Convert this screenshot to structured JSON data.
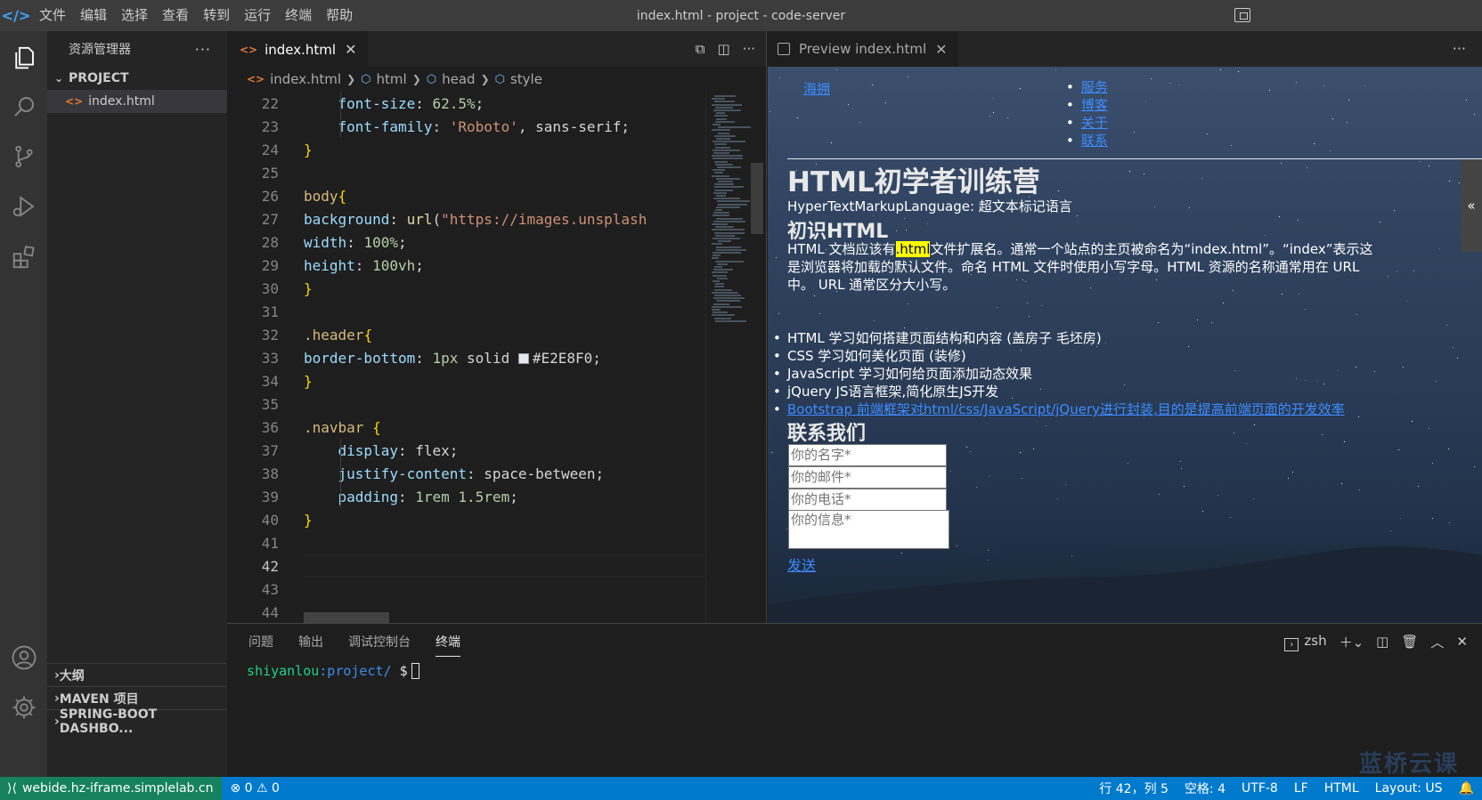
{
  "titlebar": {
    "menu": [
      "文件",
      "编辑",
      "选择",
      "查看",
      "转到",
      "运行",
      "终端",
      "帮助"
    ],
    "window_title": "index.html - project - code-server"
  },
  "sidebar": {
    "title": "资源管理器",
    "more": "···",
    "project_label": "PROJECT",
    "file": "index.html",
    "bottom_sections": [
      "大纲",
      "MAVEN 项目",
      "SPRING-BOOT DASHBO..."
    ]
  },
  "editor": {
    "tab_label": "index.html",
    "tab_close": "✕",
    "breadcrumb": [
      "index.html",
      "html",
      "head",
      "style"
    ],
    "lines": [
      {
        "n": "22",
        "parts": [
          [
            "p",
            "    font-size"
          ],
          [
            "d",
            ": "
          ],
          [
            "n",
            "62.5%"
          ],
          [
            "d",
            ";"
          ]
        ]
      },
      {
        "n": "23",
        "parts": [
          [
            "p",
            "    font-family"
          ],
          [
            "d",
            ": "
          ],
          [
            "s",
            "'Roboto'"
          ],
          [
            "d",
            ", sans-serif;"
          ]
        ]
      },
      {
        "n": "24",
        "parts": [
          [
            "b",
            "}"
          ]
        ]
      },
      {
        "n": "25",
        "parts": []
      },
      {
        "n": "26",
        "parts": [
          [
            "sel",
            "body"
          ],
          [
            "b",
            "{"
          ]
        ]
      },
      {
        "n": "27",
        "parts": [
          [
            "p",
            "background"
          ],
          [
            "d",
            ": "
          ],
          [
            "f",
            "url"
          ],
          [
            "d",
            "("
          ],
          [
            "s",
            "\"https://images.unsplash"
          ]
        ]
      },
      {
        "n": "28",
        "parts": [
          [
            "p",
            "width"
          ],
          [
            "d",
            ": "
          ],
          [
            "n",
            "100%"
          ],
          [
            "d",
            ";"
          ]
        ]
      },
      {
        "n": "29",
        "parts": [
          [
            "p",
            "height"
          ],
          [
            "d",
            ": "
          ],
          [
            "n",
            "100vh"
          ],
          [
            "d",
            ";"
          ]
        ]
      },
      {
        "n": "30",
        "parts": [
          [
            "b",
            "}"
          ]
        ]
      },
      {
        "n": "31",
        "parts": []
      },
      {
        "n": "32",
        "parts": [
          [
            "sel",
            ".header"
          ],
          [
            "b",
            "{"
          ]
        ]
      },
      {
        "n": "33",
        "parts": [
          [
            "p",
            "border-bottom"
          ],
          [
            "d",
            ": "
          ],
          [
            "n",
            "1px"
          ],
          [
            "d",
            " solid "
          ],
          [
            "sw",
            ""
          ],
          [
            "d",
            "#E2E8F0;"
          ]
        ]
      },
      {
        "n": "34",
        "parts": [
          [
            "b",
            "}"
          ]
        ]
      },
      {
        "n": "35",
        "parts": []
      },
      {
        "n": "36",
        "parts": [
          [
            "sel",
            ".navbar "
          ],
          [
            "b",
            "{"
          ]
        ]
      },
      {
        "n": "37",
        "parts": [
          [
            "p",
            "    display"
          ],
          [
            "d",
            ": flex;"
          ]
        ]
      },
      {
        "n": "38",
        "parts": [
          [
            "p",
            "    justify-content"
          ],
          [
            "d",
            ": space-between;"
          ]
        ]
      },
      {
        "n": "39",
        "parts": [
          [
            "p",
            "    padding"
          ],
          [
            "d",
            ": "
          ],
          [
            "n",
            "1rem 1.5rem"
          ],
          [
            "d",
            ";"
          ]
        ]
      },
      {
        "n": "40",
        "parts": [
          [
            "b",
            "}"
          ]
        ]
      },
      {
        "n": "41",
        "parts": []
      },
      {
        "n": "42",
        "parts": []
      },
      {
        "n": "43",
        "parts": []
      },
      {
        "n": "44",
        "parts": []
      }
    ]
  },
  "preview": {
    "tab_label": "Preview index.html",
    "logo": "海拥",
    "nav": [
      "服务",
      "博客",
      "关于",
      "联系"
    ],
    "h1": "HTML初学者训练营",
    "subtitle": "HyperTextMarkupLanguage: 超文本标记语言",
    "h2": "初识HTML",
    "para_a": "HTML 文档应该有",
    "para_highlight": ".html",
    "para_b": "文件扩展名。通常一个站点的主页被命名为“index.html”。“index”表示这是浏览器将加载的默认文件。命名 HTML 文件时使用小写字母。HTML 资源的名称通常用在 URL 中。 URL 通常区分大小写。",
    "list": [
      "HTML 学习如何搭建页面结构和内容 (盖房子 毛坯房)",
      "CSS 学习如何美化页面 (装修)",
      "JavaScript 学习如何给页面添加动态效果",
      "jQuery JS语言框架,简化原生JS开发",
      "Bootstrap 前端框架对html/css/JavaScript/jQuery进行封装,目的是提高前端页面的开发效率"
    ],
    "contact_heading": "联系我们",
    "placeholders": [
      "你的名字*",
      "你的邮件*",
      "你的电话*",
      "你的信息*"
    ],
    "send": "发送",
    "collapse": "«"
  },
  "panel": {
    "tabs": [
      "问题",
      "输出",
      "调试控制台",
      "终端"
    ],
    "active_tab": "终端",
    "shell": "zsh",
    "prompt_user": "shiyanlou",
    "prompt_path": ":project/",
    "prompt_symbol": "$",
    "watermark": "蓝桥云课"
  },
  "statusbar": {
    "remote": "webide.hz-iframe.simplelab.cn",
    "errors": "⊗ 0 ⚠ 0",
    "position": "行 42，列 5",
    "spaces": "空格: 4",
    "encoding": "UTF-8",
    "eol": "LF",
    "language": "HTML",
    "layout": "Layout: US"
  }
}
